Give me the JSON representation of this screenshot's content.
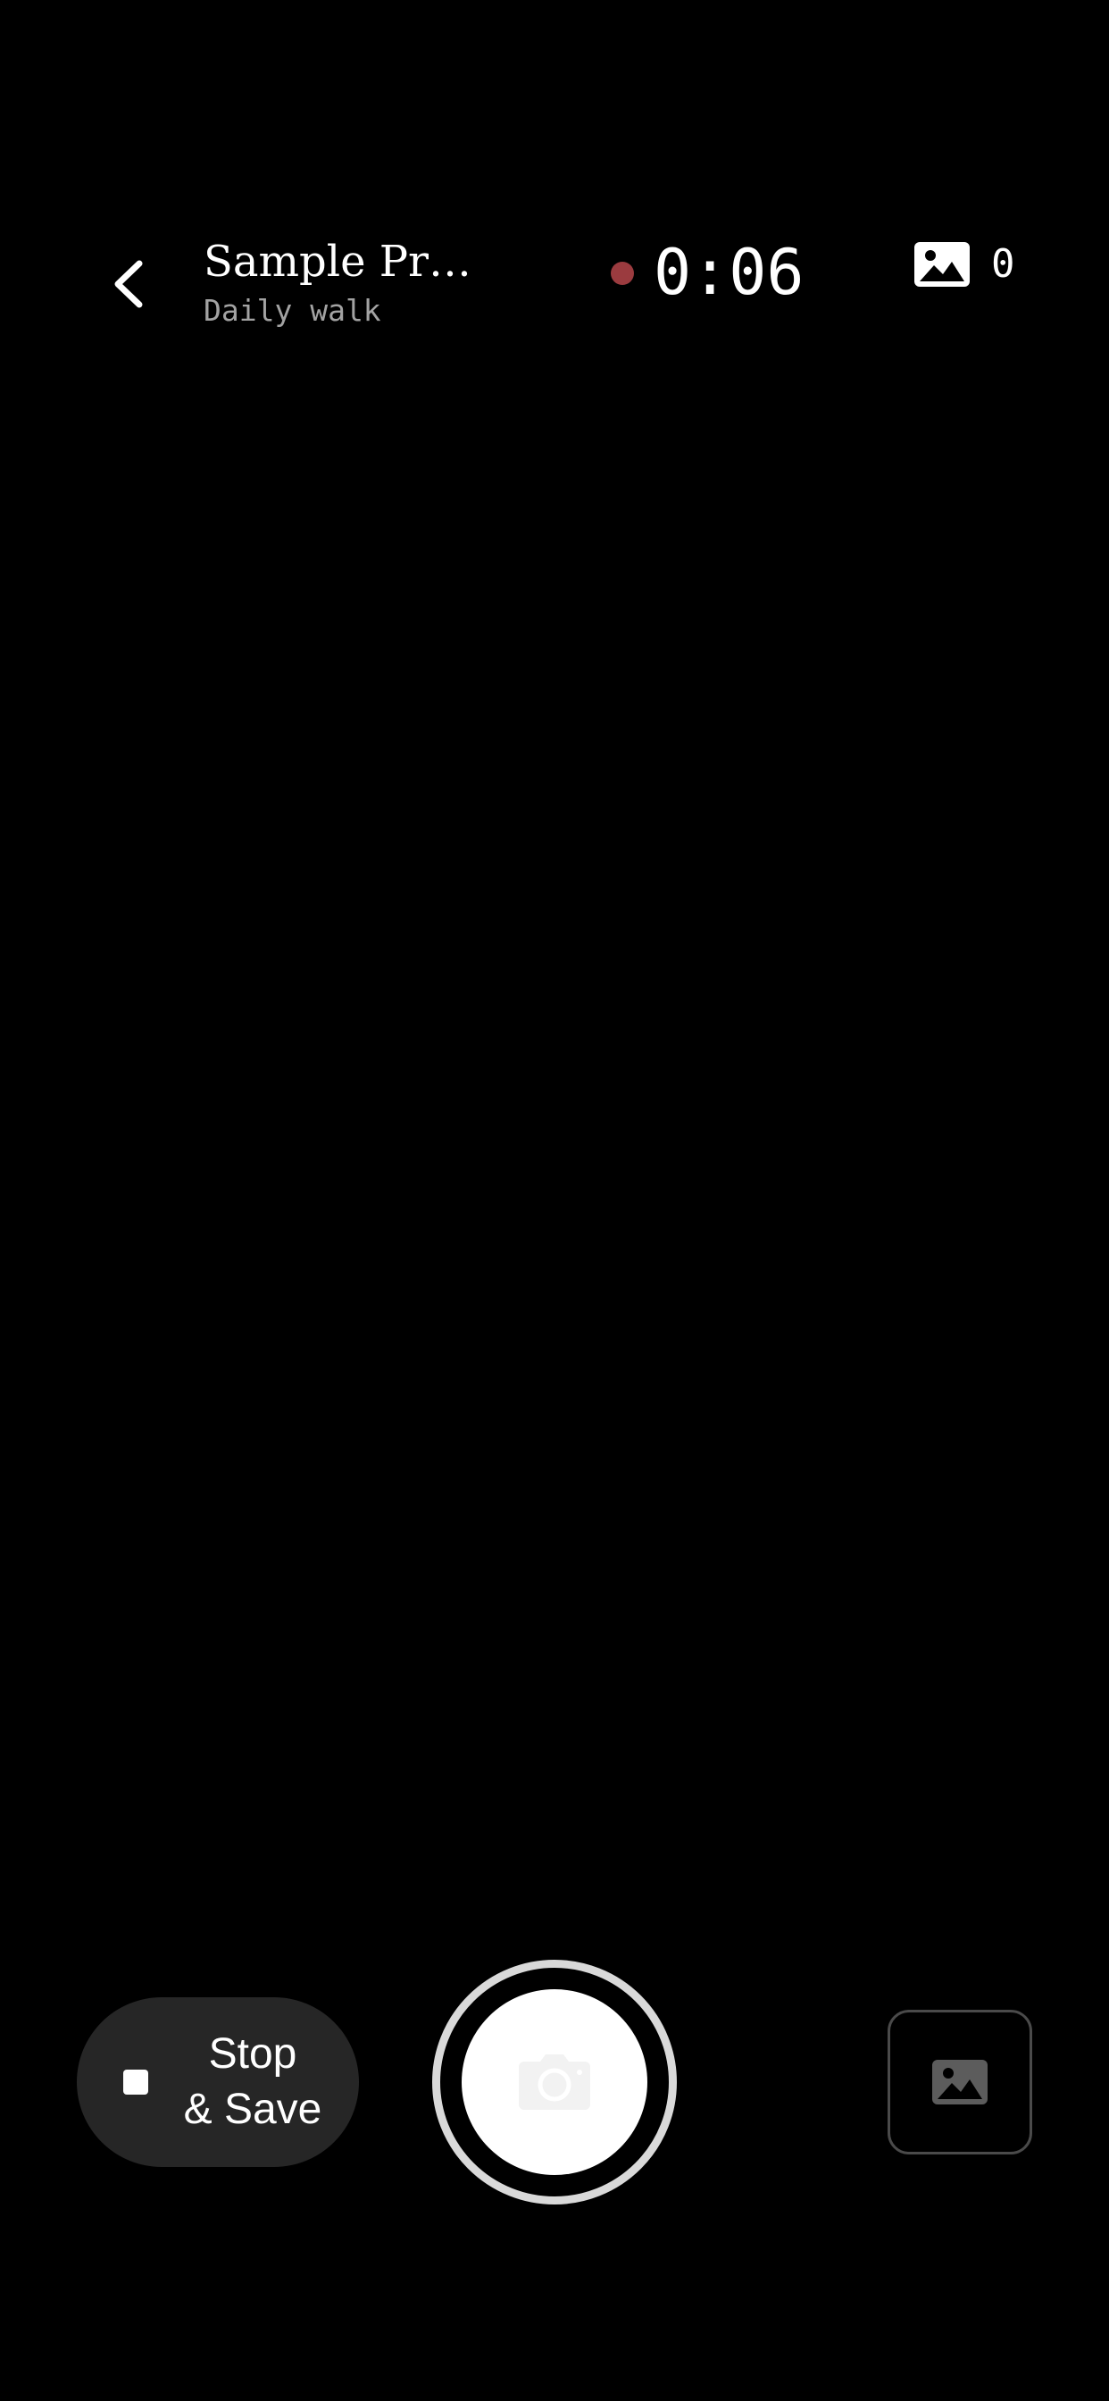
{
  "header": {
    "back_icon": "chevron-left-icon",
    "title": "Sample Pr…",
    "subtitle": "Daily walk",
    "recording_indicator_color": "#9b3b3f",
    "timer": "0:06",
    "photo_icon": "image-icon",
    "photo_count": "0"
  },
  "controls": {
    "stop_icon": "stop-square-icon",
    "stop_save_label": "Stop\n& Save",
    "shutter_icon": "camera-icon",
    "gallery_icon": "image-icon"
  },
  "colors": {
    "background": "#000000",
    "pill_background": "#262626",
    "shutter_ring": "#d9d9d9",
    "subtitle_text": "#a3a3a3",
    "gallery_border": "#4a4a4a"
  }
}
